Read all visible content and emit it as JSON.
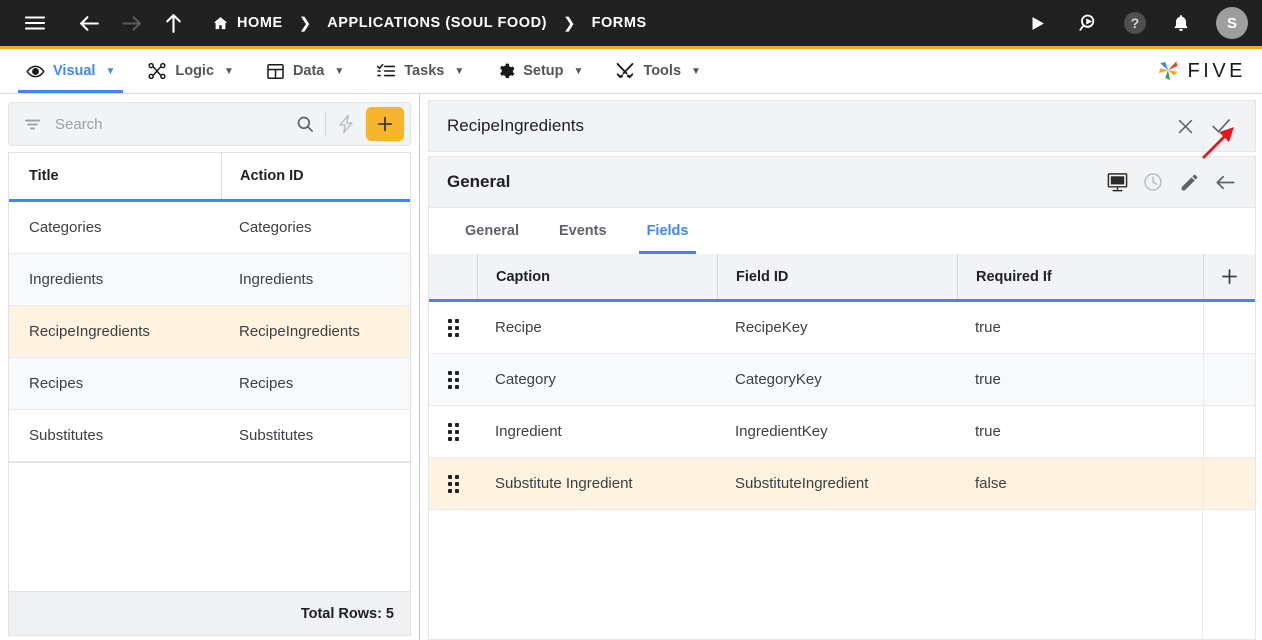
{
  "topbar": {
    "menu_icon": "hamburger-icon",
    "back_icon": "arrow-left-icon",
    "forward_icon": "arrow-right-icon",
    "up_icon": "arrow-up-icon",
    "breadcrumbs": [
      {
        "label": "HOME",
        "icon": "home-icon"
      },
      {
        "label": "APPLICATIONS (SOUL FOOD)",
        "icon": ""
      },
      {
        "label": "FORMS",
        "icon": ""
      }
    ],
    "separator": "❯",
    "actions": [
      {
        "name": "run-icon",
        "glyph": "▶"
      },
      {
        "name": "search-run-icon",
        "glyph": ""
      },
      {
        "name": "help-icon",
        "glyph": "?"
      },
      {
        "name": "notifications-bell-icon",
        "glyph": ""
      }
    ],
    "avatar_initial": "S",
    "bg_color": "#212121"
  },
  "menubar": {
    "accent_color": "#f5a623",
    "active_color": "#4285f4",
    "items": [
      {
        "label": "Visual",
        "icon": "eye-icon",
        "caret": "▼",
        "active": true
      },
      {
        "label": "Logic",
        "icon": "logic-nodes-icon",
        "caret": "▼",
        "active": false
      },
      {
        "label": "Data",
        "icon": "table-icon",
        "caret": "▼",
        "active": false
      },
      {
        "label": "Tasks",
        "icon": "checklist-icon",
        "caret": "▼",
        "active": false
      },
      {
        "label": "Setup",
        "icon": "gear-icon",
        "caret": "▼",
        "active": false
      },
      {
        "label": "Tools",
        "icon": "tools-icon",
        "caret": "▼",
        "active": false
      }
    ],
    "brand": "FIVE"
  },
  "left_panel": {
    "search": {
      "placeholder": "Search",
      "value": "",
      "filter_icon": "filter-icon",
      "search_icon": "search-icon",
      "lightning_icon": "lightning-bolt-icon",
      "add_label": "+"
    },
    "columns": [
      "Title",
      "Action ID"
    ],
    "rows": [
      {
        "title": "Categories",
        "action_id": "Categories",
        "style": ""
      },
      {
        "title": "Ingredients",
        "action_id": "Ingredients",
        "style": "alt"
      },
      {
        "title": "RecipeIngredients",
        "action_id": "RecipeIngredients",
        "style": "sel"
      },
      {
        "title": "Recipes",
        "action_id": "Recipes",
        "style": "alt"
      },
      {
        "title": "Substitutes",
        "action_id": "Substitutes",
        "style": ""
      }
    ],
    "total_rows": "Total Rows: 5"
  },
  "right_panel": {
    "title": "RecipeIngredients",
    "title_actions": [
      {
        "name": "close-icon",
        "glyph": "✕"
      },
      {
        "name": "confirm-check-icon",
        "glyph": "✓"
      }
    ],
    "section_title": "General",
    "section_actions": [
      {
        "name": "display-monitor-icon"
      },
      {
        "name": "clock-history-icon"
      },
      {
        "name": "edit-pencil-icon"
      },
      {
        "name": "back-arrow-icon"
      }
    ],
    "tabs": [
      {
        "label": "General",
        "active": false
      },
      {
        "label": "Events",
        "active": false
      },
      {
        "label": "Fields",
        "active": true
      }
    ],
    "fields_grid": {
      "columns": [
        "Caption",
        "Field ID",
        "Required If"
      ],
      "add_column_label": "+",
      "rows": [
        {
          "drag": "drag-handle-icon",
          "caption": "Recipe",
          "field_id": "RecipeKey",
          "required_if": "true",
          "style": ""
        },
        {
          "drag": "drag-handle-icon",
          "caption": "Category",
          "field_id": "CategoryKey",
          "required_if": "true",
          "style": "alt"
        },
        {
          "drag": "drag-handle-icon",
          "caption": "Ingredient",
          "field_id": "IngredientKey",
          "required_if": "true",
          "style": ""
        },
        {
          "drag": "drag-handle-icon",
          "caption": "Substitute Ingredient",
          "field_id": "SubstituteIngredient",
          "required_if": "false",
          "style": "sel"
        }
      ]
    }
  },
  "annotation": {
    "name": "red-arrow-pointer",
    "color": "#e8161a",
    "points_to": "confirm-check-icon"
  }
}
